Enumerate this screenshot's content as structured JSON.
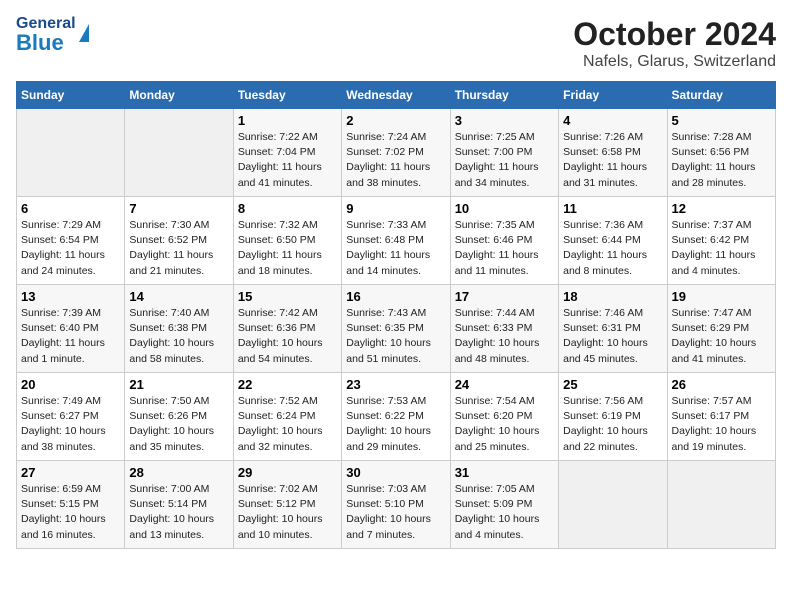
{
  "header": {
    "logo_general": "General",
    "logo_blue": "Blue",
    "title": "October 2024",
    "subtitle": "Nafels, Glarus, Switzerland"
  },
  "weekdays": [
    "Sunday",
    "Monday",
    "Tuesday",
    "Wednesday",
    "Thursday",
    "Friday",
    "Saturday"
  ],
  "weeks": [
    [
      {
        "day": "",
        "info": ""
      },
      {
        "day": "",
        "info": ""
      },
      {
        "day": "1",
        "info": "Sunrise: 7:22 AM\nSunset: 7:04 PM\nDaylight: 11 hours and 41 minutes."
      },
      {
        "day": "2",
        "info": "Sunrise: 7:24 AM\nSunset: 7:02 PM\nDaylight: 11 hours and 38 minutes."
      },
      {
        "day": "3",
        "info": "Sunrise: 7:25 AM\nSunset: 7:00 PM\nDaylight: 11 hours and 34 minutes."
      },
      {
        "day": "4",
        "info": "Sunrise: 7:26 AM\nSunset: 6:58 PM\nDaylight: 11 hours and 31 minutes."
      },
      {
        "day": "5",
        "info": "Sunrise: 7:28 AM\nSunset: 6:56 PM\nDaylight: 11 hours and 28 minutes."
      }
    ],
    [
      {
        "day": "6",
        "info": "Sunrise: 7:29 AM\nSunset: 6:54 PM\nDaylight: 11 hours and 24 minutes."
      },
      {
        "day": "7",
        "info": "Sunrise: 7:30 AM\nSunset: 6:52 PM\nDaylight: 11 hours and 21 minutes."
      },
      {
        "day": "8",
        "info": "Sunrise: 7:32 AM\nSunset: 6:50 PM\nDaylight: 11 hours and 18 minutes."
      },
      {
        "day": "9",
        "info": "Sunrise: 7:33 AM\nSunset: 6:48 PM\nDaylight: 11 hours and 14 minutes."
      },
      {
        "day": "10",
        "info": "Sunrise: 7:35 AM\nSunset: 6:46 PM\nDaylight: 11 hours and 11 minutes."
      },
      {
        "day": "11",
        "info": "Sunrise: 7:36 AM\nSunset: 6:44 PM\nDaylight: 11 hours and 8 minutes."
      },
      {
        "day": "12",
        "info": "Sunrise: 7:37 AM\nSunset: 6:42 PM\nDaylight: 11 hours and 4 minutes."
      }
    ],
    [
      {
        "day": "13",
        "info": "Sunrise: 7:39 AM\nSunset: 6:40 PM\nDaylight: 11 hours and 1 minute."
      },
      {
        "day": "14",
        "info": "Sunrise: 7:40 AM\nSunset: 6:38 PM\nDaylight: 10 hours and 58 minutes."
      },
      {
        "day": "15",
        "info": "Sunrise: 7:42 AM\nSunset: 6:36 PM\nDaylight: 10 hours and 54 minutes."
      },
      {
        "day": "16",
        "info": "Sunrise: 7:43 AM\nSunset: 6:35 PM\nDaylight: 10 hours and 51 minutes."
      },
      {
        "day": "17",
        "info": "Sunrise: 7:44 AM\nSunset: 6:33 PM\nDaylight: 10 hours and 48 minutes."
      },
      {
        "day": "18",
        "info": "Sunrise: 7:46 AM\nSunset: 6:31 PM\nDaylight: 10 hours and 45 minutes."
      },
      {
        "day": "19",
        "info": "Sunrise: 7:47 AM\nSunset: 6:29 PM\nDaylight: 10 hours and 41 minutes."
      }
    ],
    [
      {
        "day": "20",
        "info": "Sunrise: 7:49 AM\nSunset: 6:27 PM\nDaylight: 10 hours and 38 minutes."
      },
      {
        "day": "21",
        "info": "Sunrise: 7:50 AM\nSunset: 6:26 PM\nDaylight: 10 hours and 35 minutes."
      },
      {
        "day": "22",
        "info": "Sunrise: 7:52 AM\nSunset: 6:24 PM\nDaylight: 10 hours and 32 minutes."
      },
      {
        "day": "23",
        "info": "Sunrise: 7:53 AM\nSunset: 6:22 PM\nDaylight: 10 hours and 29 minutes."
      },
      {
        "day": "24",
        "info": "Sunrise: 7:54 AM\nSunset: 6:20 PM\nDaylight: 10 hours and 25 minutes."
      },
      {
        "day": "25",
        "info": "Sunrise: 7:56 AM\nSunset: 6:19 PM\nDaylight: 10 hours and 22 minutes."
      },
      {
        "day": "26",
        "info": "Sunrise: 7:57 AM\nSunset: 6:17 PM\nDaylight: 10 hours and 19 minutes."
      }
    ],
    [
      {
        "day": "27",
        "info": "Sunrise: 6:59 AM\nSunset: 5:15 PM\nDaylight: 10 hours and 16 minutes."
      },
      {
        "day": "28",
        "info": "Sunrise: 7:00 AM\nSunset: 5:14 PM\nDaylight: 10 hours and 13 minutes."
      },
      {
        "day": "29",
        "info": "Sunrise: 7:02 AM\nSunset: 5:12 PM\nDaylight: 10 hours and 10 minutes."
      },
      {
        "day": "30",
        "info": "Sunrise: 7:03 AM\nSunset: 5:10 PM\nDaylight: 10 hours and 7 minutes."
      },
      {
        "day": "31",
        "info": "Sunrise: 7:05 AM\nSunset: 5:09 PM\nDaylight: 10 hours and 4 minutes."
      },
      {
        "day": "",
        "info": ""
      },
      {
        "day": "",
        "info": ""
      }
    ]
  ]
}
